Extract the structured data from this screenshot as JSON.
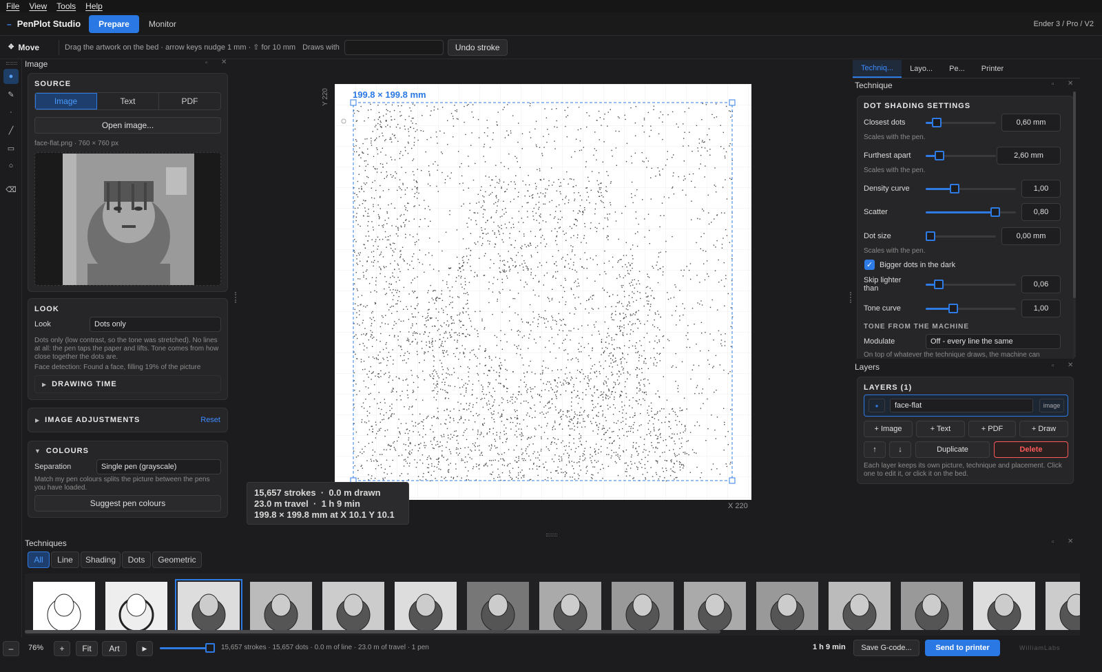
{
  "menu": [
    "File",
    "View",
    "Tools",
    "Help"
  ],
  "app": {
    "name": "PenPlot Studio",
    "tabs": [
      "Prepare",
      "Monitor"
    ],
    "machine": "Ender 3 / Pro / V2"
  },
  "toolbar": {
    "tool": "Move",
    "hint": "Drag the artwork on the bed · arrow keys nudge 1 mm · ⇧ for 10 mm",
    "draws_with_label": "Draws with",
    "draws_with_value": "",
    "undo": "Undo stroke"
  },
  "left": {
    "pane_title": "Image",
    "source": {
      "title": "SOURCE",
      "tabs": [
        "Image",
        "Text",
        "PDF"
      ],
      "open_button": "Open image...",
      "file_info": "face-flat.png  ·  760 × 760 px"
    },
    "look": {
      "title": "LOOK",
      "label": "Look",
      "value": "Dots only",
      "description": "Dots only (low contrast, so the tone was stretched). No lines at all: the pen taps the paper and lifts. Tone comes from how close together the dots are.",
      "face_detection": "Face detection: Found a face, filling 19% of the picture",
      "drawing_time": "DRAWING TIME"
    },
    "adjustments": {
      "title": "IMAGE ADJUSTMENTS",
      "reset": "Reset"
    },
    "colours": {
      "title": "COLOURS",
      "separation_label": "Separation",
      "separation_value": "Single pen (grayscale)",
      "description": "Match my pen colours splits the picture between the pens you have loaded.",
      "suggest": "Suggest pen colours"
    }
  },
  "canvas": {
    "size_label": "199.8 × 199.8 mm",
    "axis_y": "Y 220",
    "axis_x": "X 220",
    "stats": {
      "line1a": "15,657 strokes",
      "line1b": "0.0 m drawn",
      "line2a": "23.0 m travel",
      "line2b": "1 h 9 min",
      "line3": "199.8 × 199.8 mm at X 10.1  Y 10.1"
    }
  },
  "right": {
    "tabs": [
      "Techniq...",
      "Layo...",
      "Pe...",
      "Printer"
    ],
    "pane_title": "Technique",
    "section": "DOT SHADING SETTINGS",
    "settings": [
      {
        "label": "Closest dots",
        "value": "0,60 mm",
        "hint": "Scales with the pen.",
        "level": 0.1
      },
      {
        "label": "Furthest apart",
        "value": "2,60 mm",
        "hint": "Scales with the pen.",
        "level": 0.15
      },
      {
        "label": "Density curve",
        "value": "1,00",
        "level": 0.3
      },
      {
        "label": "Scatter",
        "value": "0,80",
        "level": 0.8
      },
      {
        "label": "Dot size",
        "value": "0,00 mm",
        "hint": "Scales with the pen.",
        "level": 0.0
      },
      {
        "label": "Skip lighter than",
        "value": "0,06",
        "level": 0.1
      },
      {
        "label": "Tone curve",
        "value": "1,00",
        "level": 0.28
      }
    ],
    "checkbox": {
      "label": "Bigger dots in the dark",
      "checked": true
    },
    "tone_section": "TONE FROM THE MACHINE",
    "modulate_label": "Modulate",
    "modulate_value": "Off - every line the same",
    "modulate_hint": "On top of whatever the technique draws, the machine can",
    "layers": {
      "pane_title": "Layers",
      "title": "LAYERS  (1)",
      "layer_name": "face-flat",
      "layer_type": "image",
      "add_buttons": [
        "+ Image",
        "+ Text",
        "+ PDF",
        "+ Draw"
      ],
      "up": "↑",
      "down": "↓",
      "duplicate": "Duplicate",
      "delete": "Delete",
      "help": "Each layer keeps its own picture, technique and placement. Click one to edit it, or click it on the bed."
    }
  },
  "techniques": {
    "title": "Techniques",
    "tabs": [
      "All",
      "Line",
      "Shading",
      "Dots",
      "Geometric"
    ]
  },
  "bottom": {
    "zoom_out": "–",
    "zoom": "76%",
    "zoom_in": "+",
    "fit": "Fit",
    "art": "Art",
    "play": "▶",
    "progress": 1.0,
    "summary": "15,657 strokes · 15,657 dots · 0.0 m of line · 23.0 m of travel · 1 pen",
    "time": "1 h 9 min",
    "save": "Save G-code...",
    "send": "Send to printer",
    "brand": "WilliamLabs"
  },
  "colors": {
    "accent": "#2a78e4",
    "danger": "#ff5a5a",
    "background": "#1c1c1e",
    "panel": "#262628"
  },
  "icons": [
    "cursor-icon",
    "pen-icon",
    "dot-icon",
    "line-icon",
    "rectangle-icon",
    "circle-icon",
    "eraser-icon",
    "move-icon",
    "play-icon",
    "checkbox-icon"
  ]
}
